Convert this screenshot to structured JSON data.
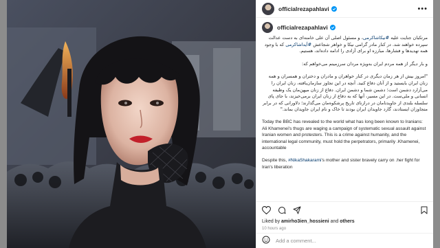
{
  "post": {
    "username": "officialrezapahlavi",
    "caption_username": "officialrezapahlavi",
    "caption_fa_1_pre": "مرتکبان جنایت علیه ",
    "caption_fa_1_tag": "#نیکاشاکرمی",
    "caption_fa_1_post": "، و مسئول اصلی آن علی خامنه‌ای به دست عدالت سپرده خواهند شد. در کنار مادر گرامی نیکا و خواهر شجاعش",
    "caption_fa_2_tag": "#آیداشاکرمی",
    "caption_fa_2_post": " که با وجود همه تهدیدها و فشارها، مبارزه او برای آزادی را ادامه داده‌اند، هستیم.",
    "caption_fa_3": "و بار دیگر از همه مردم ایران به‌ویژه مردان سرزمینم می‌خواهم که:",
    "caption_fa_4": "\"امروز بیش از هر زمان دیگری در کنار خواهران و مادران و دختران و همسران و همه زنان ایران بایستید و از آنان دفاع کنید. آنچه در این تجاوز سازمان‌یافته، زنان ایران را می‌آزارد دشمن است؛ دشمن شما و دشمن ایران. دفاع از زنان میهن‌مان یک وظیفه انسانی و ملی‌ست. در این مسیر، آنها که به دفاع از زنان ایران برمی‌خیزند، با جای پای سلسله بلندی از جاویدنامان در درازنای تاریخ پرشکوه‌مان می‌گذارند؛ دلاورانی که در برابر متجاوزان ایستادند، گارد جاویدان ایران بودند تا خاک و نام ایران جاویدان بماند.\"",
    "caption_en_1": "Today the BBC has revealed to the world what has long been known to Iranians: Ali Khamenei's thugs are waging a campaign of systematic sexual assault against Iranian women and protesters. This is a crime against humanity, and the international legal community, must hold the perpetrators, primarily .Khamenei, accountable",
    "caption_en_2_pre": "Despite this, ",
    "caption_en_2_tag": "#NikaShakarami",
    "caption_en_2_post": "'s mother and sister bravely carry on .her fight for Iran's liberation",
    "likes_prefix": "Liked by ",
    "likes_user": "amirho3ien_hossieni",
    "likes_mid": " and ",
    "likes_others": "others",
    "time": "10 hours ago",
    "comment_placeholder": "Add a comment..."
  },
  "colors": {
    "link": "#00376b",
    "verified": "#0095f6",
    "muted": "#8e8e8e"
  },
  "icons": [
    "more-icon",
    "verified-icon",
    "heart-icon",
    "comment-icon",
    "share-icon",
    "bookmark-icon",
    "emoji-icon"
  ]
}
